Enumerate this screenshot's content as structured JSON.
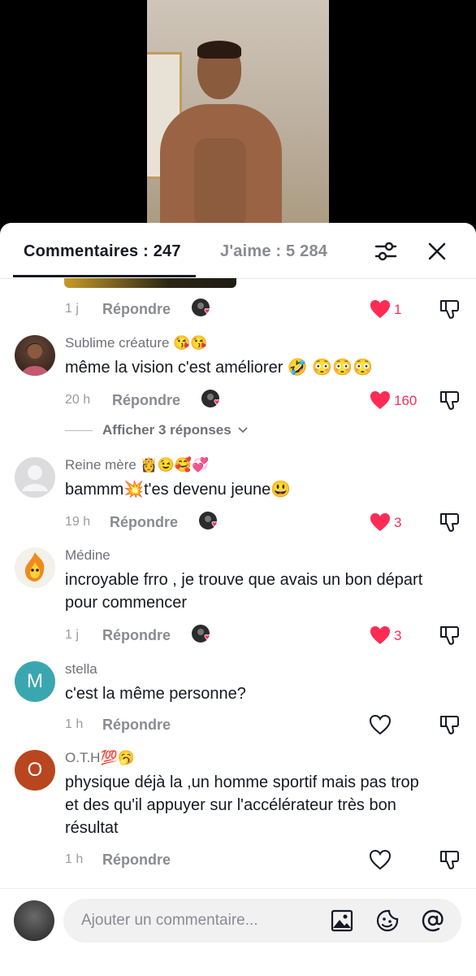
{
  "tabs": {
    "comments_label": "Commentaires : 247",
    "likes_label": "J'aime : 5 284"
  },
  "comments": [
    {
      "time": "1 j",
      "reply_label": "Répondre",
      "like_count": "1",
      "liked": true
    },
    {
      "username": "Sublime créature 😘😘",
      "text": "même la vision c'est améliorer 🤣 😳😳😳",
      "time": "20 h",
      "reply_label": "Répondre",
      "like_count": "160",
      "liked": true,
      "view_replies": "Afficher 3 réponses"
    },
    {
      "username": "Reine mère 👸😉🥰💞",
      "text": "bammm💥t'es devenu jeune😃",
      "time": "19 h",
      "reply_label": "Répondre",
      "like_count": "3",
      "liked": true
    },
    {
      "username": "Médine",
      "text": "incroyable frro , je trouve que avais un bon départ pour commencer",
      "time": "1 j",
      "reply_label": "Répondre",
      "like_count": "3",
      "liked": true
    },
    {
      "username": "stella",
      "avatar_letter": "M",
      "text": "c'est la même personne?",
      "time": "1 h",
      "reply_label": "Répondre",
      "liked": false
    },
    {
      "username": "O.T.H💯🥱",
      "avatar_letter": "O",
      "text": "physique déjà la ,un homme sportif mais pas trop et des qu'il appuyer sur l'accélérateur très bon résultat",
      "time": "1 h",
      "reply_label": "Répondre",
      "liked": false
    }
  ],
  "composer": {
    "placeholder": "Ajouter un commentaire..."
  },
  "colors": {
    "like_red": "#fe2c55",
    "avatar_teal": "#3aa7b0",
    "avatar_rust": "#b8461f"
  },
  "icons": [
    "filter-icon",
    "close-icon",
    "heart-icon",
    "dislike-icon",
    "image-icon",
    "emoji-sticker-icon",
    "mention-icon",
    "chevron-down-icon"
  ]
}
